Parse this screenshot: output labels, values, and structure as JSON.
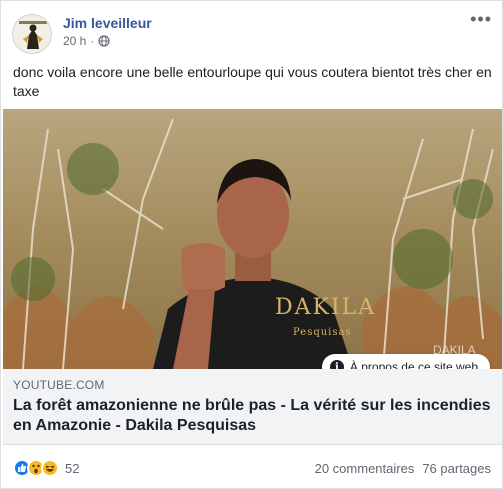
{
  "post": {
    "author": "Jim leveilleur",
    "time": "20 h",
    "separator": "·",
    "privacy_icon": "globe-icon",
    "more_icon": "more-options-icon",
    "more_glyph": "•••",
    "text": "donc voila encore une belle entourloupe qui vous coutera bientot très cher en taxe"
  },
  "media": {
    "shirt_brand": "DAKILA",
    "shirt_sub": "Pesquisas",
    "watermark": "DAKILA",
    "about_label": "À propos de ce site web",
    "about_icon": "info-icon",
    "about_glyph": "i"
  },
  "link": {
    "domain": "YOUTUBE.COM",
    "title": "La forêt amazonienne ne brûle pas - La vérité sur les incendies en Amazonie - Dakila Pesquisas"
  },
  "footer": {
    "reaction_icons": [
      "like-icon",
      "wow-icon",
      "haha-icon"
    ],
    "reaction_count": "52",
    "comments": "20 commentaires",
    "shares": "76 partages"
  },
  "colors": {
    "author_link": "#385898",
    "like_blue": "#1877f2",
    "reaction_yellow": "#f7b928",
    "muted_text": "#606770",
    "link_bg": "#f2f3f5"
  }
}
